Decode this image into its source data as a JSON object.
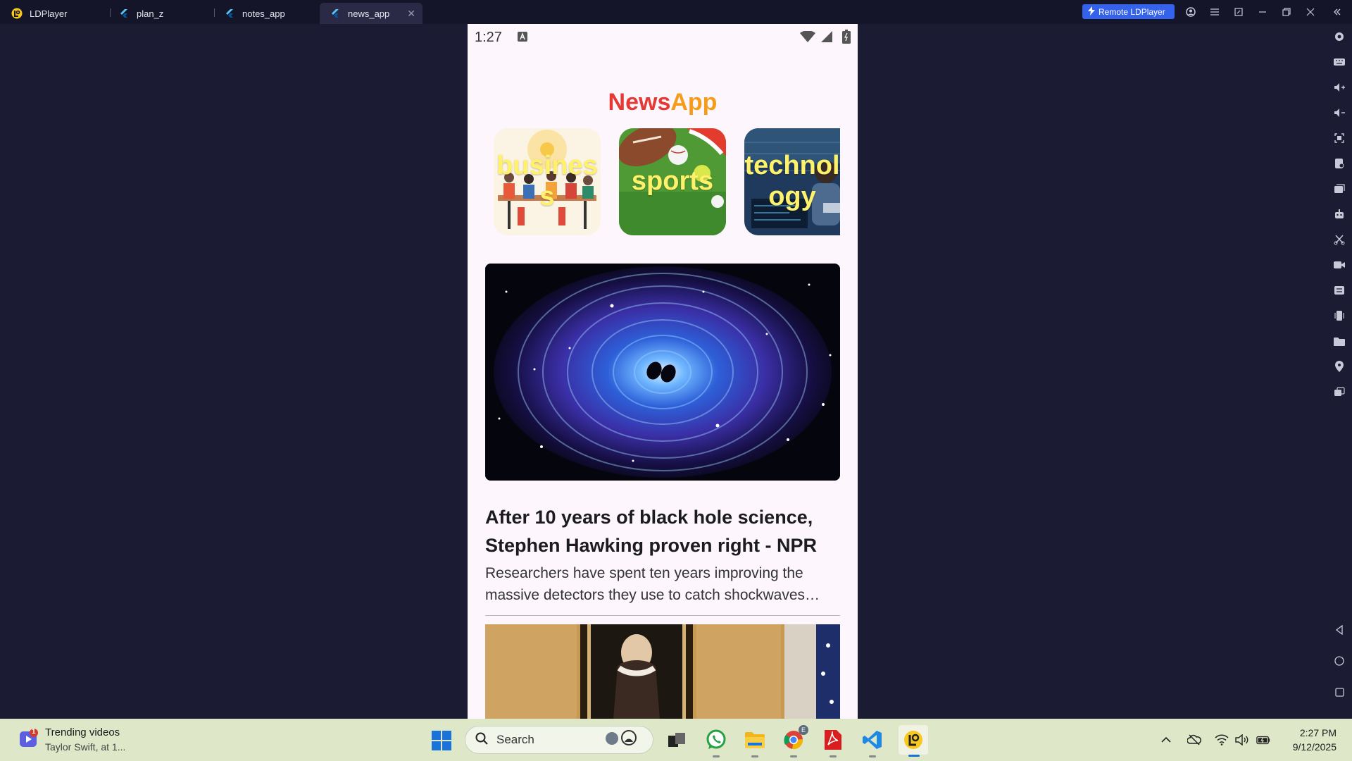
{
  "window": {
    "tabs": [
      {
        "label": "LDPlayer",
        "icon": "ldplayer-logo-icon"
      },
      {
        "label": "plan_z",
        "icon": "flutter-icon"
      },
      {
        "label": "notes_app",
        "icon": "flutter-icon"
      },
      {
        "label": "news_app",
        "icon": "flutter-icon"
      }
    ],
    "close_tab_glyph": "✕",
    "remote_label": "Remote LDPlayer"
  },
  "phone": {
    "status": {
      "time": "1:27"
    },
    "app_title_part1": "News",
    "app_title_part2": "App",
    "title_colors": {
      "part1": "#e53935",
      "part2": "#f59c1a"
    },
    "categories": [
      {
        "label": "business"
      },
      {
        "label": "sports"
      },
      {
        "label": "technology"
      }
    ],
    "articles": [
      {
        "title": "After 10 years of black hole science, Stephen Hawking proven right - NPR",
        "description": "Researchers have spent ten years improving the massive detectors they use to catch shockwaves…"
      }
    ]
  },
  "taskbar": {
    "notification": {
      "badge": "1",
      "title": "Trending videos",
      "subtitle": "Taylor Swift, at 1..."
    },
    "search_placeholder": "Search",
    "clock_time": "2:27 PM",
    "clock_date": "9/12/2025",
    "chrome_badge": "E"
  }
}
